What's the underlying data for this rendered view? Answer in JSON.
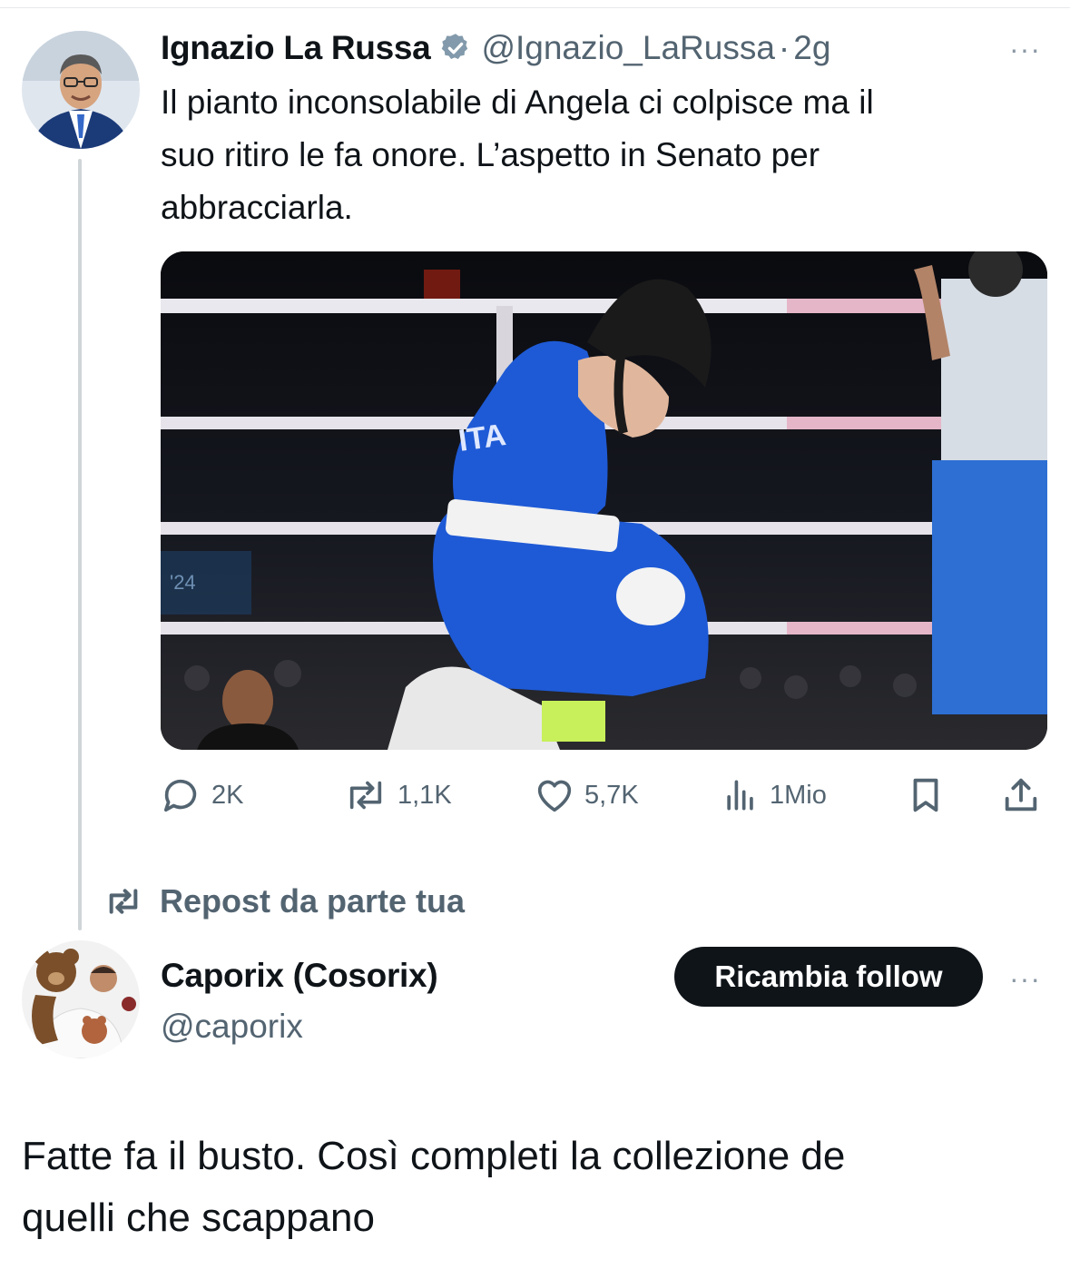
{
  "original_tweet": {
    "author_name": "Ignazio La Russa",
    "handle": "@Ignazio_LaRussa",
    "separator": "·",
    "time": "2g",
    "more": "···",
    "text_lines": [
      "Il pianto inconsolabile di Angela ci colpisce ma il",
      "suo ritiro le fa onore. L’aspetto in Senato per",
      "abbracciarla."
    ],
    "photo_caption": "ITA",
    "photo_number": "'24",
    "actions": {
      "replies": "2K",
      "reposts": "1,1K",
      "likes": "5,7K",
      "views": "1Mio"
    }
  },
  "repost_label": "Repost da parte tua",
  "quote_user": {
    "name": "Caporix (Cosorix)",
    "handle": "@caporix",
    "follow_button": "Ricambia follow",
    "more": "···"
  },
  "reply_text_lines": [
    "Fatte fa il busto. Così completi la collezione de",
    "quelli che scappano"
  ],
  "colors": {
    "text": "#0f1419",
    "secondary": "#536471",
    "verified": "#829aab",
    "button_bg": "#0f1419",
    "boxer_blue": "#1e5ad6"
  }
}
